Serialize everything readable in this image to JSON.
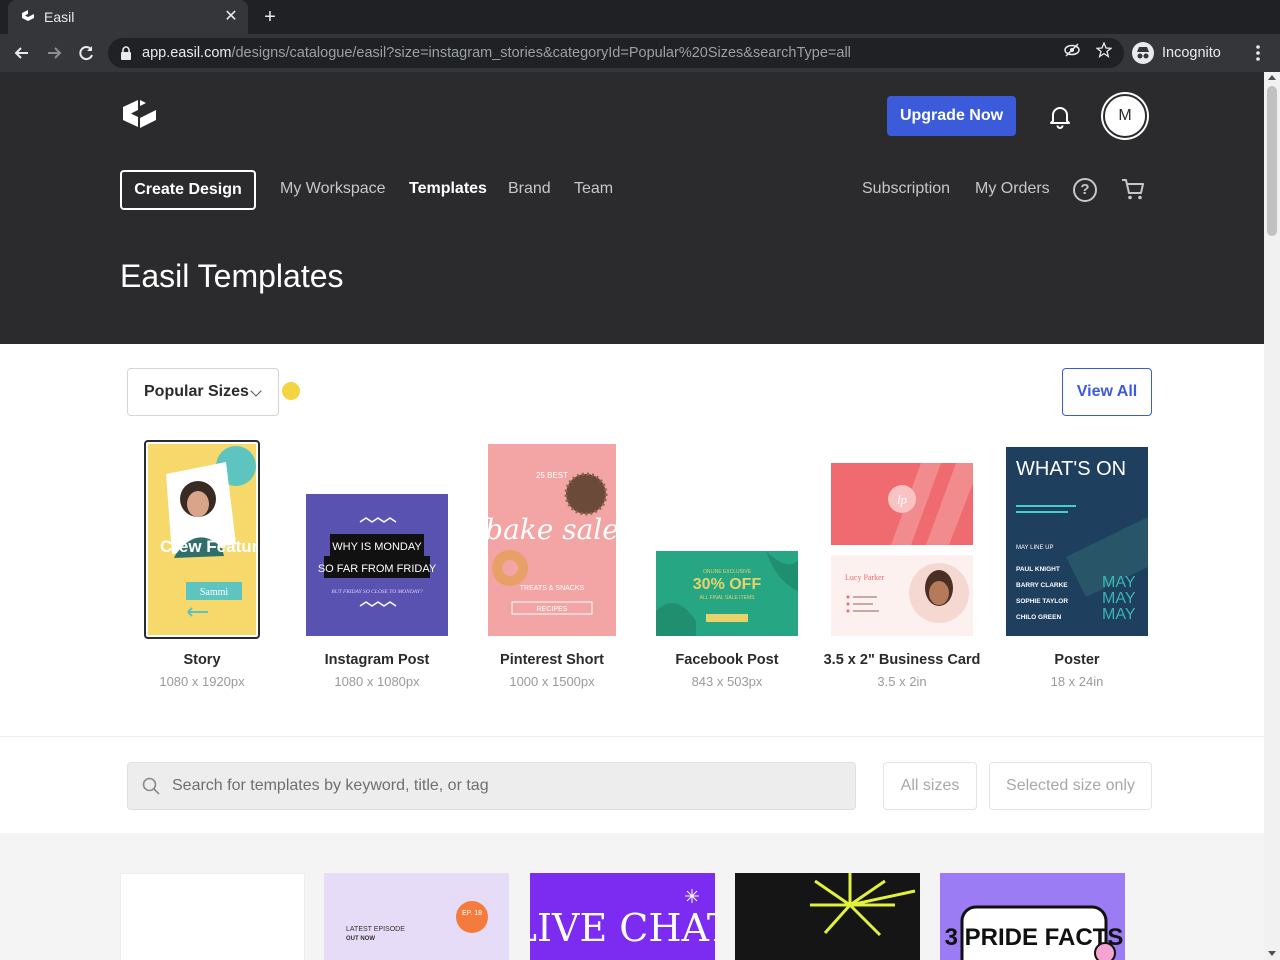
{
  "browser": {
    "tab_title": "Easil",
    "close_glyph": "✕",
    "newtab_glyph": "+",
    "url_host": "app.easil.com",
    "url_path": "/designs/catalogue/easil?size=instagram_stories&categoryId=Popular%20Sizes&searchType=all",
    "profile_label": "Incognito",
    "icons": [
      "back-icon",
      "forward-icon",
      "reload-icon",
      "lock-icon",
      "eye-off-icon",
      "star-icon",
      "incognito-icon",
      "menu-icon"
    ]
  },
  "header": {
    "upgrade_label": "Upgrade Now",
    "avatar_initial": "M",
    "create_label": "Create Design",
    "nav": {
      "workspace": "My Workspace",
      "templates": "Templates",
      "brand": "Brand",
      "team": "Team",
      "subscription": "Subscription",
      "orders": "My Orders"
    },
    "help_glyph": "?",
    "page_title": "Easil Templates"
  },
  "sizes": {
    "dropdown_value": "Popular Sizes",
    "view_all_label": "View All",
    "items": [
      {
        "label": "Story",
        "dims": "1080 x 1920px",
        "selected": true
      },
      {
        "label": "Instagram Post",
        "dims": "1080 x 1080px"
      },
      {
        "label": "Pinterest Short",
        "dims": "1000 x 1500px"
      },
      {
        "label": "Facebook Post",
        "dims": "843 x 503px"
      },
      {
        "label": "3.5 x 2\" Business Card",
        "dims": "3.5 x 2in"
      },
      {
        "label": "Poster",
        "dims": "18 x 24in"
      }
    ]
  },
  "thumb_text": {
    "story_title": "Crew Feature",
    "story_name": "Sammi",
    "ig_line1": "WHY IS MONDAY",
    "ig_line2": "SO FAR FROM FRIDAY",
    "ig_sub": "BUT FRIDAY SO CLOSE TO MONDAY?",
    "pin_top": "25 BEST",
    "pin_main": "bake sale",
    "pin_sub": "TREATS & SNACKS",
    "pin_btn": "RECIPES",
    "fb_top": "ONLINE EXCLUSIVE",
    "fb_main": "30% OFF",
    "fb_sub": "ALL FINAL SALE ITEMS",
    "bc_logo": "lp",
    "bc_name": "Lucy Parker",
    "poster_title": "WHAT'S ON",
    "poster_lineup": "MAY LINE UP",
    "poster_acts": [
      "PAUL KNIGHT",
      "BARRY CLARKE",
      "SOPHIE TAYLOR",
      "CHILO GREEN"
    ],
    "poster_side": "MAY",
    "t2_top": "LATEST EPISODE",
    "t2_sub": "OUT NOW",
    "t2_badge": "EP. 18",
    "t3_main": "LIVE CHAT",
    "t5_main": "3 PRIDE FACTS"
  },
  "search": {
    "placeholder": "Search for templates by keyword, title, or tag",
    "all_sizes_label": "All sizes",
    "selected_size_label": "Selected size only"
  },
  "colors": {
    "accent": "#3b5bdb",
    "header_bg": "#2b2b2d",
    "cursor_highlight": "#f5d442"
  }
}
